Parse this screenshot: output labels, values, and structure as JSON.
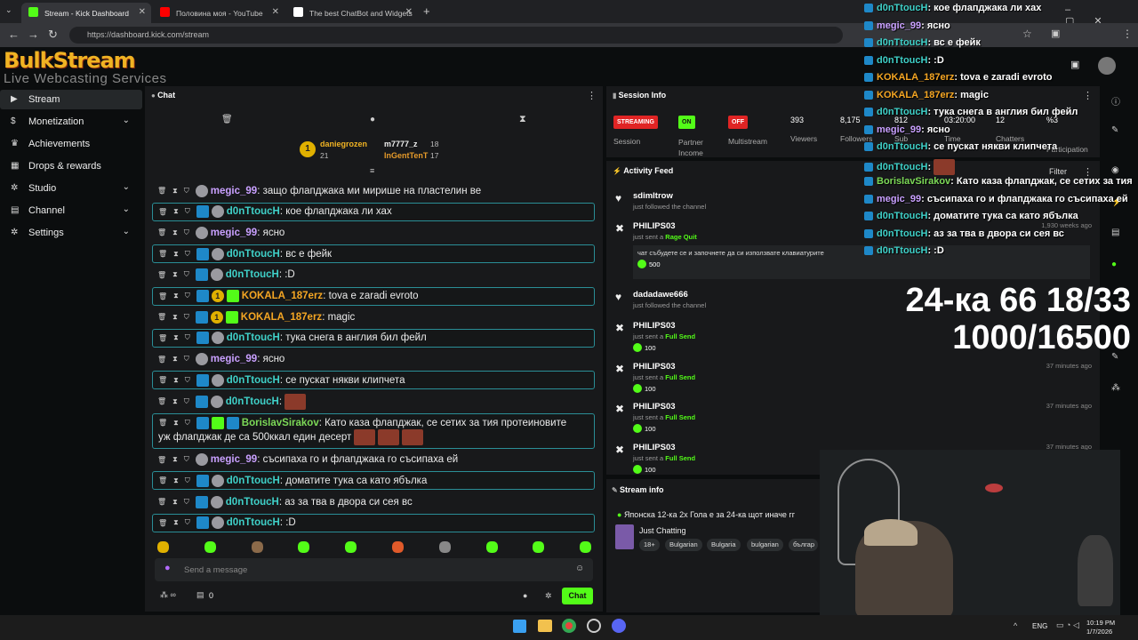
{
  "browser": {
    "tabs": [
      {
        "label": "Stream - Kick Dashboard",
        "color": "#53fc18"
      },
      {
        "label": "Половина моя - YouTube",
        "color": "#ff0000"
      },
      {
        "label": "The best ChatBot and Widgets",
        "color": "#ffffff"
      }
    ],
    "url": "https://dashboard.kick.com/stream"
  },
  "logo": {
    "line1": "BulkStream",
    "line2": "Live Webcasting Services"
  },
  "sidebar": {
    "items": [
      {
        "label": "Stream",
        "icon": "video-icon",
        "expand": false
      },
      {
        "label": "Monetization",
        "icon": "dollar-icon",
        "expand": true
      },
      {
        "label": "Achievements",
        "icon": "trophy-icon",
        "expand": false
      },
      {
        "label": "Drops & rewards",
        "icon": "gift-icon",
        "expand": false
      },
      {
        "label": "Studio",
        "icon": "gear-icon",
        "expand": true
      },
      {
        "label": "Channel",
        "icon": "link-icon",
        "expand": true
      },
      {
        "label": "Settings",
        "icon": "gear-icon",
        "expand": true
      }
    ]
  },
  "chat": {
    "title": "Chat",
    "top_gifters": [
      {
        "name": "daniegrozen",
        "count": "21",
        "rank": "1"
      },
      {
        "name": "m7777_z",
        "count": "18"
      },
      {
        "name": "InGentTenT",
        "count": "17"
      }
    ],
    "messages": [
      {
        "user": "megic_99",
        "text": ": защо флапджака ми мирише на пластелин ве",
        "color": "#c9a0ff",
        "badges": "av"
      },
      {
        "user": "d0nTtoucH",
        "text": ": кое флапджака ли хах",
        "color": "#3fd0c8",
        "badges": "sub"
      },
      {
        "user": "megic_99",
        "text": ": ясно",
        "color": "#c9a0ff",
        "badges": "av"
      },
      {
        "user": "d0nTtoucH",
        "text": ": вс е фейк",
        "color": "#3fd0c8",
        "badges": "sub"
      },
      {
        "user": "d0nTtoucH",
        "text": ": :D",
        "color": "#3fd0c8",
        "badges": "sub"
      },
      {
        "user": "KOKALA_187erz",
        "text": ": tova e zaradi evroto",
        "color": "#f5a623",
        "badges": "coin"
      },
      {
        "user": "KOKALA_187erz",
        "text": ": magic",
        "color": "#f5a623",
        "badges": "coin"
      },
      {
        "user": "d0nTtoucH",
        "text": ": тука снега в англия бил фейл",
        "color": "#3fd0c8",
        "badges": "sub"
      },
      {
        "user": "megic_99",
        "text": ": ясно",
        "color": "#c9a0ff",
        "badges": "av"
      },
      {
        "user": "d0nTtoucH",
        "text": ": се пускат някви клипчета",
        "color": "#3fd0c8",
        "badges": "sub"
      },
      {
        "user": "d0nTtoucH",
        "text": ":",
        "color": "#3fd0c8",
        "badges": "sub"
      },
      {
        "user": "BorislavSirakov",
        "text": ": Като каза флапджак, се сетих за тия протеиновите",
        "text2": "уж флапджак де са 500ккал един десерт",
        "color": "#7cd957",
        "badges": "gift"
      },
      {
        "user": "megic_99",
        "text": ": съсипаха го и флапджака го съсипаха ей",
        "color": "#c9a0ff",
        "badges": "av"
      },
      {
        "user": "d0nTtoucH",
        "text": ": доматите тука са като ябълка",
        "color": "#3fd0c8",
        "badges": "sub"
      },
      {
        "user": "d0nTtoucH",
        "text": ": аз за тва в двора си сея вс",
        "color": "#3fd0c8",
        "badges": "sub"
      },
      {
        "user": "d0nTtoucH",
        "text": ": :D",
        "color": "#3fd0c8",
        "badges": "sub"
      }
    ],
    "input_placeholder": "Send a message",
    "send_label": "Chat",
    "viewer_count": "0"
  },
  "session": {
    "title": "Session Info",
    "labels": [
      "Session",
      "Partner Income",
      "Multistream",
      "Viewers",
      "Followers",
      "Sub",
      "Time",
      "Chatters",
      "Participation"
    ],
    "status": {
      "streaming": "STREAMING",
      "partner": "ON",
      "multi": "OFF"
    },
    "values": {
      "viewers": "393",
      "followers": "8,175",
      "subs": "812",
      "time": "03:20:00",
      "chatters": "12",
      "pct": "%3"
    }
  },
  "activity": {
    "title": "Activity Feed",
    "filter": "Filter",
    "items": [
      {
        "name": "sdimltrow",
        "sub": "just followed the channel",
        "ago": "",
        "amount": ""
      },
      {
        "name": "PHILIPS03",
        "sub": "just sent a ",
        "hl": "Rage Quit",
        "ago": "1,930 weeks ago",
        "msg": "чат събудете се и започнете да си използвате клавиатурите",
        "amount": "500"
      },
      {
        "name": "dadadawe666",
        "sub": "just followed the channel",
        "ago": "",
        "amount": ""
      },
      {
        "name": "PHILIPS03",
        "sub": "just sent a ",
        "hl": "Full Send",
        "ago": "",
        "amount": "100"
      },
      {
        "name": "PHILIPS03",
        "sub": "just sent a ",
        "hl": "Full Send",
        "ago": "37 minutes ago",
        "amount": "100"
      },
      {
        "name": "PHILIPS03",
        "sub": "just sent a ",
        "hl": "Full Send",
        "ago": "37 minutes ago",
        "amount": "100"
      },
      {
        "name": "PHILIPS03",
        "sub": "just sent a ",
        "hl": "Full Send",
        "ago": "37 minutes ago",
        "amount": "100"
      }
    ]
  },
  "stream_info": {
    "title": "Stream info",
    "stream_title": "Японска 12-ка 2х Гола е за 24-ка щот иначе гг",
    "category": "Just Chatting",
    "tags": [
      "18+",
      "Bulgarian",
      "Bulgaria",
      "bulgarian",
      "българ"
    ]
  },
  "overlay_chat": [
    {
      "user": "d0nTtoucH",
      "text": ": кое флапджака ли хах",
      "color": "#3fd0c8"
    },
    {
      "user": "megic_99",
      "text": ": ясно",
      "color": "#c9a0ff"
    },
    {
      "user": "d0nTtoucH",
      "text": ": вс е фейк",
      "color": "#3fd0c8"
    },
    {
      "user": "d0nTtoucH",
      "text": ": :D",
      "color": "#3fd0c8"
    },
    {
      "user": "KOKALA_187erz",
      "text": ": tova e zaradi evroto",
      "color": "#f5a623"
    },
    {
      "user": "KOKALA_187erz",
      "text": ": magic",
      "color": "#f5a623"
    },
    {
      "user": "d0nTtoucH",
      "text": ": тука снега в англия бил фейл",
      "color": "#3fd0c8"
    },
    {
      "user": "megic_99",
      "text": ": ясно",
      "color": "#c9a0ff"
    },
    {
      "user": "d0nTtoucH",
      "text": ": се пускат някви клипчета",
      "color": "#3fd0c8"
    },
    {
      "user": "d0nTtoucH",
      "text": ":",
      "color": "#3fd0c8"
    },
    {
      "user": "BorislavSirakov",
      "text": ": Като каза флапджак, се сетих за тия",
      "color": "#7cd957"
    },
    {
      "user": "megic_99",
      "text": ": съсипаха го и флапджака го съсипаха ей",
      "color": "#c9a0ff"
    },
    {
      "user": "d0nTtoucH",
      "text": ": доматите тука са като ябълка",
      "color": "#3fd0c8"
    },
    {
      "user": "d0nTtoucH",
      "text": ": аз за тва в двора си сея вс",
      "color": "#3fd0c8"
    },
    {
      "user": "d0nTtoucH",
      "text": ": :D",
      "color": "#3fd0c8"
    }
  ],
  "overlay_big": {
    "line1": "24-ка 66 18/33",
    "line2": "1000/16500"
  },
  "taskbar": {
    "lang": "ENG",
    "time": "10:19 PM",
    "date": "1/7/2026"
  }
}
